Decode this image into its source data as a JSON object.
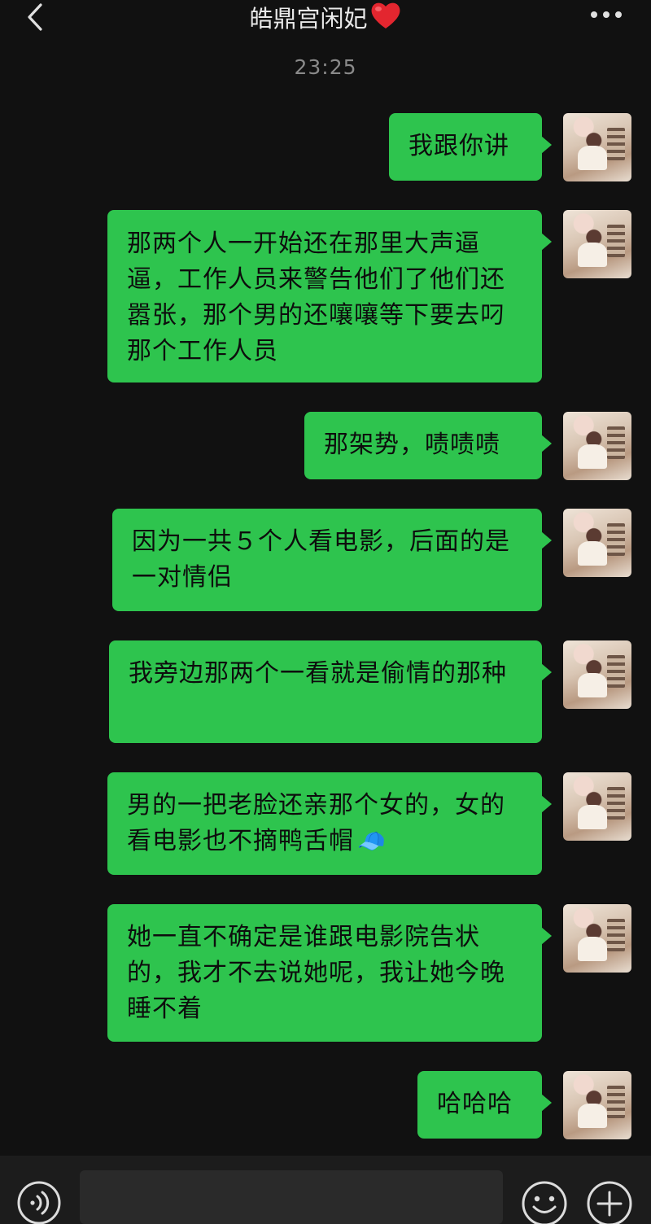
{
  "header": {
    "title": "皓鼎宫闲妃",
    "title_emoji": "heart",
    "back_icon": "chevron-left-icon",
    "more_icon": "more-dots-icon"
  },
  "chat": {
    "timestamp": "23:25",
    "messages": [
      {
        "text": "我跟你讲",
        "sender": "self"
      },
      {
        "text": "那两个人一开始还在那里大声逼逼，工作人员来警告他们了他们还嚣张，那个男的还嚷嚷等下要去叼那个工作人员",
        "sender": "self"
      },
      {
        "text": "那架势，啧啧啧",
        "sender": "self"
      },
      {
        "text": "因为一共５个人看电影，后面的是一对情侣",
        "sender": "self"
      },
      {
        "text": "我旁边那两个一看就是偷情的那种",
        "sender": "self"
      },
      {
        "text": "男的一把老脸还亲那个女的，女的看电影也不摘鸭舌帽",
        "sender": "self",
        "emoji": "🧢"
      },
      {
        "text": "她一直不确定是谁跟电影院告状的，我才不去说她呢，我让她今晚睡不着",
        "sender": "self"
      },
      {
        "text": "哈哈哈",
        "sender": "self"
      }
    ]
  },
  "input_bar": {
    "input_value": "",
    "voice_icon": "voice-icon",
    "emoji_icon": "emoji-icon",
    "plus_icon": "plus-icon"
  },
  "colors": {
    "background": "#111111",
    "bubble": "#2ec44e",
    "text_dark": "#0d0d0d",
    "header_text": "#e8e8e8",
    "timestamp": "#8a8a8a"
  }
}
